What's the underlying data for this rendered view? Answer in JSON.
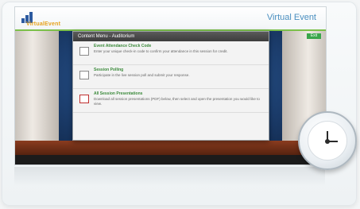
{
  "header": {
    "logo_text": "VirtualEvent",
    "title": "Virtual Event"
  },
  "stage": {
    "exit_label": "Exit"
  },
  "dialog": {
    "title": "Content Menu - Auditorium",
    "items": [
      {
        "label": "Event Attendance Check Code",
        "description": "Enter your unique check-in code to confirm your attendance in this session for credit."
      },
      {
        "label": "Session Polling",
        "description": "Participate in the live session poll and submit your response."
      },
      {
        "label": "All Session Presentations",
        "description": "Download all session presentations (PDF) below, then select and open the presentation you would like to view."
      }
    ]
  },
  "colors": {
    "accent_green": "#7cc04a",
    "title_blue": "#4a8fc0",
    "stage_blue": "#2e5f9b"
  }
}
